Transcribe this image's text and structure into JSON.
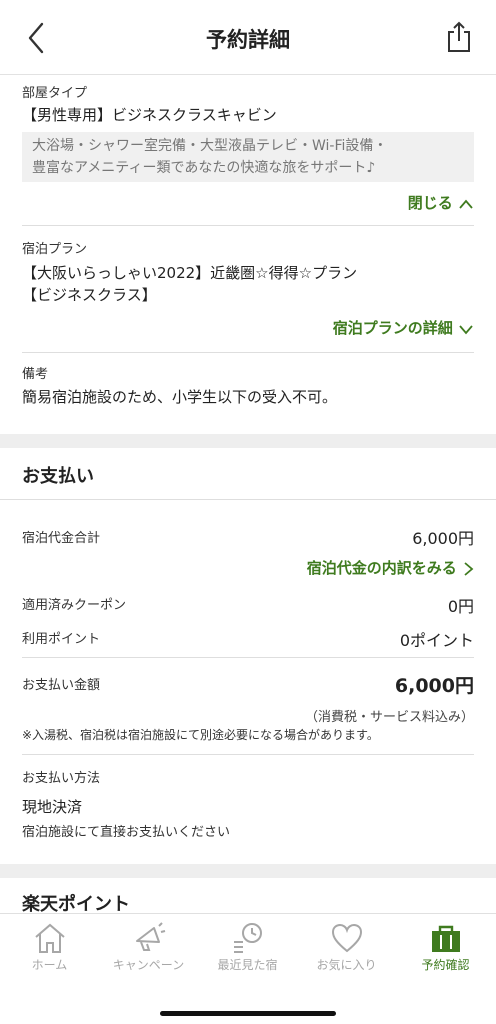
{
  "header": {
    "title": "予約詳細"
  },
  "room": {
    "label": "部屋タイプ",
    "name": "【男性専用】ビジネスクラスキャビン",
    "description_line1": "大浴場・シャワー室完備・大型液晶テレビ・Wi-Fi設備・",
    "description_line2": "豊富なアメニティー類であなたの快適な旅をサポート♪",
    "close_label": "閉じる"
  },
  "plan": {
    "label": "宿泊プラン",
    "name_line1": "【大阪いらっしゃい2022】近畿圏☆得得☆プラン",
    "name_line2": "【ビジネスクラス】",
    "detail_label": "宿泊プランの詳細"
  },
  "remarks": {
    "label": "備考",
    "text": "簡易宿泊施設のため、小学生以下の受入不可。"
  },
  "payment": {
    "heading": "お支払い",
    "total_label": "宿泊代金合計",
    "total_value": "6,000円",
    "breakdown_link": "宿泊代金の内訳をみる",
    "coupon_label": "適用済みクーポン",
    "coupon_value": "0円",
    "points_label": "利用ポイント",
    "points_value": "0ポイント",
    "amount_label": "お支払い金額",
    "amount_value": "6,000円",
    "tax_note": "（消費税・サービス料込み）",
    "extra_note": "※入湯税、宿泊税は宿泊施設にて別途必要になる場合があります。",
    "method_label": "お支払い方法",
    "method_value": "現地決済",
    "method_note": "宿泊施設にて直接お支払いください"
  },
  "rakuten_points": {
    "heading": "楽天ポイント"
  },
  "tabs": [
    {
      "label": "ホーム",
      "icon": "home-icon"
    },
    {
      "label": "キャンペーン",
      "icon": "megaphone-icon"
    },
    {
      "label": "最近見た宿",
      "icon": "history-icon"
    },
    {
      "label": "お気に入り",
      "icon": "heart-icon"
    },
    {
      "label": "予約確認",
      "icon": "bag-icon"
    }
  ],
  "colors": {
    "accent": "#3f7b1f",
    "inactive": "#a7a7a7",
    "band": "#eeeeee"
  }
}
